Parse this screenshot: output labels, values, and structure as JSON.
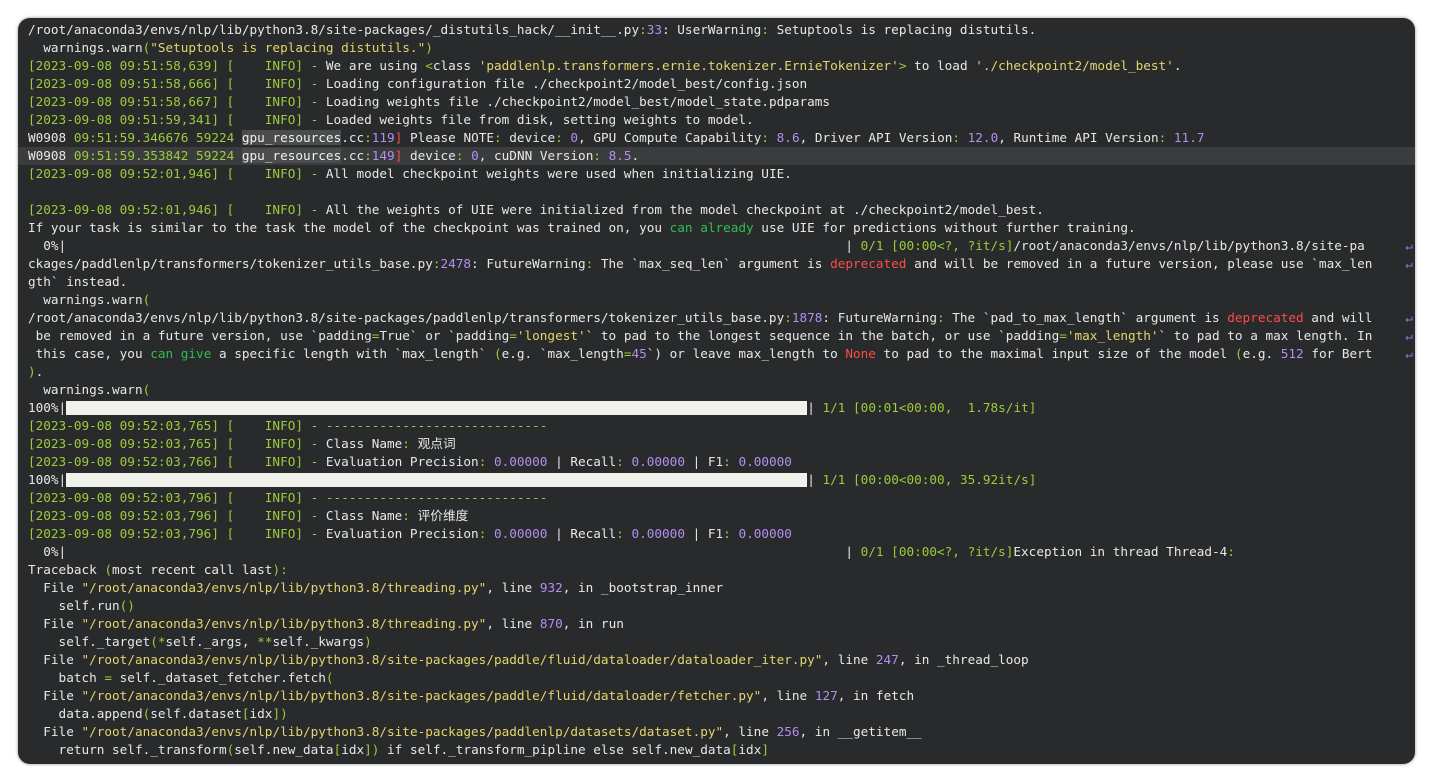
{
  "lines": [
    {
      "segs": [
        {
          "t": "/root/anaconda3/envs/nlp/lib/python3.8/site-packages/_distutils_hack/__init__.py"
        },
        {
          "t": ":",
          "c": "g"
        },
        {
          "t": "33",
          "c": "p"
        },
        {
          "t": ": UserWarning"
        },
        {
          "t": ":",
          "c": "g"
        },
        {
          "t": " Setuptools is replacing distutils."
        }
      ]
    },
    {
      "segs": [
        {
          "t": "  warnings.warn"
        },
        {
          "t": "(",
          "c": "g"
        },
        {
          "t": "\"Setuptools is replacing distutils.\"",
          "c": "y"
        },
        {
          "t": ")",
          "c": "g"
        }
      ]
    },
    {
      "segs": [
        {
          "t": "[2023-09-08 09:51:58,639] [    INFO] - ",
          "c": "g"
        },
        {
          "t": "We are using "
        },
        {
          "t": "<",
          "c": "g"
        },
        {
          "t": "class "
        },
        {
          "t": "'paddlenlp.transformers.ernie.tokenizer.ErnieTokenizer'",
          "c": "y"
        },
        {
          "t": ">",
          "c": "g"
        },
        {
          "t": " to load "
        },
        {
          "t": "'./checkpoint2/model_best'",
          "c": "y"
        },
        {
          "t": "."
        }
      ]
    },
    {
      "segs": [
        {
          "t": "[2023-09-08 09:51:58,666] [    INFO] - ",
          "c": "g"
        },
        {
          "t": "Loading configuration file ./checkpoint2/model_best/config.json"
        }
      ]
    },
    {
      "segs": [
        {
          "t": "[2023-09-08 09:51:58,667] [    INFO] - ",
          "c": "g"
        },
        {
          "t": "Loading weights file ./checkpoint2/model_best/model_state.pdparams"
        }
      ]
    },
    {
      "segs": [
        {
          "t": "[2023-09-08 09:51:59,341] [    INFO] - ",
          "c": "g"
        },
        {
          "t": "Loaded weights file from disk, setting weights to model."
        }
      ]
    },
    {
      "segs": [
        {
          "t": "W0908 "
        },
        {
          "t": "09:51:59.346676 59224",
          "c": "g"
        },
        {
          "t": " "
        },
        {
          "t": "gpu_resources",
          "c": "gb"
        },
        {
          "t": ".cc"
        },
        {
          "t": ":",
          "c": "g"
        },
        {
          "t": "119",
          "c": "p"
        },
        {
          "t": "]",
          "c": "r"
        },
        {
          "t": " Please NOTE"
        },
        {
          "t": ":",
          "c": "g"
        },
        {
          "t": " device"
        },
        {
          "t": ":",
          "c": "g"
        },
        {
          "t": " "
        },
        {
          "t": "0",
          "c": "p"
        },
        {
          "t": ", GPU Compute Capability"
        },
        {
          "t": ":",
          "c": "g"
        },
        {
          "t": " "
        },
        {
          "t": "8.6",
          "c": "p"
        },
        {
          "t": ", Driver API Version"
        },
        {
          "t": ":",
          "c": "g"
        },
        {
          "t": " "
        },
        {
          "t": "12.0",
          "c": "p"
        },
        {
          "t": ", Runtime API Version"
        },
        {
          "t": ":",
          "c": "g"
        },
        {
          "t": " "
        },
        {
          "t": "11.7",
          "c": "p"
        }
      ]
    },
    {
      "hl": true,
      "segs": [
        {
          "t": "W0908 "
        },
        {
          "t": "09:51:59.353842 59224",
          "c": "g"
        },
        {
          "t": " "
        },
        {
          "t": "gpu_resources",
          "c": "gb"
        },
        {
          "t": ".cc"
        },
        {
          "t": ":",
          "c": "g"
        },
        {
          "t": "149",
          "c": "p"
        },
        {
          "t": "]",
          "c": "r"
        },
        {
          "t": " device"
        },
        {
          "t": ":",
          "c": "g"
        },
        {
          "t": " "
        },
        {
          "t": "0",
          "c": "p"
        },
        {
          "t": ", cuDNN Version"
        },
        {
          "t": ":",
          "c": "g"
        },
        {
          "t": " "
        },
        {
          "t": "8.5",
          "c": "p"
        },
        {
          "t": "."
        }
      ]
    },
    {
      "segs": [
        {
          "t": "[2023-09-08 09:52:01,946] [    INFO] - ",
          "c": "g"
        },
        {
          "t": "All model checkpoint weights were used when initializing UIE."
        }
      ]
    },
    {
      "segs": [
        {
          "t": " "
        }
      ]
    },
    {
      "segs": [
        {
          "t": "[2023-09-08 09:52:01,946] [    INFO] - ",
          "c": "g"
        },
        {
          "t": "All the weights of UIE were initialized from the model checkpoint at ./checkpoint2/model_best."
        }
      ]
    },
    {
      "segs": [
        {
          "t": "If your task is similar to the task the model of the checkpoint was trained on, you "
        },
        {
          "t": "can already",
          "c": "gr"
        },
        {
          "t": " use UIE for predictions without further training."
        }
      ]
    },
    {
      "wrap": true,
      "segs": [
        {
          "t": "  0%|"
        },
        {
          "pad": 102
        },
        {
          "t": "| "
        },
        {
          "t": "0/1 [00:00<?, ?it/s]",
          "c": "g"
        },
        {
          "t": "/root/anaconda3/envs/nlp/lib/python3.8/site-pa"
        }
      ]
    },
    {
      "wrap": true,
      "segs": [
        {
          "t": "ckages/paddlenlp/transformers/tokenizer_utils_base.py"
        },
        {
          "t": ":",
          "c": "g"
        },
        {
          "t": "2478",
          "c": "p"
        },
        {
          "t": ": FutureWarning"
        },
        {
          "t": ":",
          "c": "g"
        },
        {
          "t": " The `max_seq_len` argument is "
        },
        {
          "t": "deprecated",
          "c": "r"
        },
        {
          "t": " and will be removed in a future version, please use `max_len"
        }
      ]
    },
    {
      "segs": [
        {
          "t": "gth` instead."
        }
      ]
    },
    {
      "segs": [
        {
          "t": "  warnings.warn"
        },
        {
          "t": "(",
          "c": "g"
        }
      ]
    },
    {
      "wrap": true,
      "segs": [
        {
          "t": "/root/anaconda3/envs/nlp/lib/python3.8/site-packages/paddlenlp/transformers/tokenizer_utils_base.py"
        },
        {
          "t": ":",
          "c": "g"
        },
        {
          "t": "1878",
          "c": "p"
        },
        {
          "t": ": FutureWarning"
        },
        {
          "t": ":",
          "c": "g"
        },
        {
          "t": " The `pad_to_max_length` argument is "
        },
        {
          "t": "deprecated",
          "c": "r"
        },
        {
          "t": " and will"
        }
      ]
    },
    {
      "wrap": true,
      "segs": [
        {
          "t": " be removed in a future version, use `padding"
        },
        {
          "t": "=",
          "c": "g"
        },
        {
          "t": "True` or `padding"
        },
        {
          "t": "=",
          "c": "g"
        },
        {
          "t": "'longest'",
          "c": "y"
        },
        {
          "t": "` to pad to the longest sequence in the batch, or use `padding"
        },
        {
          "t": "=",
          "c": "g"
        },
        {
          "t": "'max_length'",
          "c": "y"
        },
        {
          "t": "` to pad to a max length. In"
        }
      ]
    },
    {
      "wrap": true,
      "segs": [
        {
          "t": " this case, you "
        },
        {
          "t": "can give",
          "c": "gr"
        },
        {
          "t": " a specific length with `max_length` "
        },
        {
          "t": "(",
          "c": "g"
        },
        {
          "t": "e.g. `max_length"
        },
        {
          "t": "=",
          "c": "g"
        },
        {
          "t": "45",
          "c": "p"
        },
        {
          "t": "`) or leave max_length to "
        },
        {
          "t": "None",
          "c": "r"
        },
        {
          "t": " to pad to the maximal input size of the model "
        },
        {
          "t": "(",
          "c": "g"
        },
        {
          "t": "e.g. "
        },
        {
          "t": "512",
          "c": "p"
        },
        {
          "t": " for Bert"
        }
      ]
    },
    {
      "segs": [
        {
          "t": ")",
          "c": "g"
        },
        {
          "t": "."
        }
      ]
    },
    {
      "segs": [
        {
          "t": "  warnings.warn"
        },
        {
          "t": "(",
          "c": "g"
        }
      ]
    },
    {
      "segs": [
        {
          "t": "100%|"
        },
        {
          "bar": true
        },
        {
          "t": "| "
        },
        {
          "t": "1/1 [00:01<00:00,  1.78s/it]",
          "c": "g"
        }
      ]
    },
    {
      "segs": [
        {
          "t": "[2023-09-08 09:52:03,765] [    INFO] - -----------------------------",
          "c": "g"
        }
      ]
    },
    {
      "segs": [
        {
          "t": "[2023-09-08 09:52:03,765] [    INFO] - ",
          "c": "g"
        },
        {
          "t": "Class Name"
        },
        {
          "t": ":",
          "c": "g"
        },
        {
          "t": " 观点词"
        }
      ]
    },
    {
      "segs": [
        {
          "t": "[2023-09-08 09:52:03,766] [    INFO] - ",
          "c": "g"
        },
        {
          "t": "Evaluation Precision"
        },
        {
          "t": ":",
          "c": "g"
        },
        {
          "t": " "
        },
        {
          "t": "0.00000",
          "c": "p"
        },
        {
          "t": " | Recall"
        },
        {
          "t": ":",
          "c": "g"
        },
        {
          "t": " "
        },
        {
          "t": "0.00000",
          "c": "p"
        },
        {
          "t": " | F1"
        },
        {
          "t": ":",
          "c": "g"
        },
        {
          "t": " "
        },
        {
          "t": "0.00000",
          "c": "p"
        }
      ]
    },
    {
      "segs": [
        {
          "t": "100%|"
        },
        {
          "bar": true
        },
        {
          "t": "| "
        },
        {
          "t": "1/1 [00:00<00:00, 35.92it/s]",
          "c": "g"
        }
      ]
    },
    {
      "segs": [
        {
          "t": "[2023-09-08 09:52:03,796] [    INFO] - -----------------------------",
          "c": "g"
        }
      ]
    },
    {
      "segs": [
        {
          "t": "[2023-09-08 09:52:03,796] [    INFO] - ",
          "c": "g"
        },
        {
          "t": "Class Name"
        },
        {
          "t": ":",
          "c": "g"
        },
        {
          "t": " 评价维度"
        }
      ]
    },
    {
      "segs": [
        {
          "t": "[2023-09-08 09:52:03,796] [    INFO] - ",
          "c": "g"
        },
        {
          "t": "Evaluation Precision"
        },
        {
          "t": ":",
          "c": "g"
        },
        {
          "t": " "
        },
        {
          "t": "0.00000",
          "c": "p"
        },
        {
          "t": " | Recall"
        },
        {
          "t": ":",
          "c": "g"
        },
        {
          "t": " "
        },
        {
          "t": "0.00000",
          "c": "p"
        },
        {
          "t": " | F1"
        },
        {
          "t": ":",
          "c": "g"
        },
        {
          "t": " "
        },
        {
          "t": "0.00000",
          "c": "p"
        }
      ]
    },
    {
      "segs": [
        {
          "t": "  0%|"
        },
        {
          "pad": 102
        },
        {
          "t": "| "
        },
        {
          "t": "0/1 [00:00<?, ?it/s]",
          "c": "g"
        },
        {
          "t": "Exception in thread Thread-4"
        },
        {
          "t": ":",
          "c": "g"
        }
      ]
    },
    {
      "segs": [
        {
          "t": "Traceback "
        },
        {
          "t": "(",
          "c": "g"
        },
        {
          "t": "most recent call last"
        },
        {
          "t": "):",
          "c": "g"
        }
      ]
    },
    {
      "segs": [
        {
          "t": "  File "
        },
        {
          "t": "\"/root/anaconda3/envs/nlp/lib/python3.8/threading.py\"",
          "c": "y"
        },
        {
          "t": ", line "
        },
        {
          "t": "932",
          "c": "p"
        },
        {
          "t": ", in _bootstrap_inner"
        }
      ]
    },
    {
      "segs": [
        {
          "t": "    self.run"
        },
        {
          "t": "()",
          "c": "g"
        }
      ]
    },
    {
      "segs": [
        {
          "t": "  File "
        },
        {
          "t": "\"/root/anaconda3/envs/nlp/lib/python3.8/threading.py\"",
          "c": "y"
        },
        {
          "t": ", line "
        },
        {
          "t": "870",
          "c": "p"
        },
        {
          "t": ", in run"
        }
      ]
    },
    {
      "segs": [
        {
          "t": "    self._target"
        },
        {
          "t": "(*",
          "c": "g"
        },
        {
          "t": "self._args, "
        },
        {
          "t": "**",
          "c": "g"
        },
        {
          "t": "self._kwargs"
        },
        {
          "t": ")",
          "c": "g"
        }
      ]
    },
    {
      "segs": [
        {
          "t": "  File "
        },
        {
          "t": "\"/root/anaconda3/envs/nlp/lib/python3.8/site-packages/paddle/fluid/dataloader/dataloader_iter.py\"",
          "c": "y"
        },
        {
          "t": ", line "
        },
        {
          "t": "247",
          "c": "p"
        },
        {
          "t": ", in _thread_loop"
        }
      ]
    },
    {
      "segs": [
        {
          "t": "    batch "
        },
        {
          "t": "=",
          "c": "g"
        },
        {
          "t": " self._dataset_fetcher.fetch"
        },
        {
          "t": "(",
          "c": "g"
        }
      ]
    },
    {
      "segs": [
        {
          "t": "  File "
        },
        {
          "t": "\"/root/anaconda3/envs/nlp/lib/python3.8/site-packages/paddle/fluid/dataloader/fetcher.py\"",
          "c": "y"
        },
        {
          "t": ", line "
        },
        {
          "t": "127",
          "c": "p"
        },
        {
          "t": ", in fetch"
        }
      ]
    },
    {
      "segs": [
        {
          "t": "    data.append"
        },
        {
          "t": "(",
          "c": "g"
        },
        {
          "t": "self.dataset"
        },
        {
          "t": "[",
          "c": "g"
        },
        {
          "t": "idx"
        },
        {
          "t": "])",
          "c": "g"
        }
      ]
    },
    {
      "segs": [
        {
          "t": "  File "
        },
        {
          "t": "\"/root/anaconda3/envs/nlp/lib/python3.8/site-packages/paddlenlp/datasets/dataset.py\"",
          "c": "y"
        },
        {
          "t": ", line "
        },
        {
          "t": "256",
          "c": "p"
        },
        {
          "t": ", in __getitem__"
        }
      ]
    },
    {
      "segs": [
        {
          "t": "    return self._transform"
        },
        {
          "t": "(",
          "c": "g"
        },
        {
          "t": "self.new_data"
        },
        {
          "t": "[",
          "c": "g"
        },
        {
          "t": "idx"
        },
        {
          "t": "])",
          "c": "g"
        },
        {
          "t": " if self._transform_pipline else self.new_data"
        },
        {
          "t": "[",
          "c": "g"
        },
        {
          "t": "idx"
        },
        {
          "t": "]",
          "c": "g"
        }
      ]
    }
  ],
  "progress_bars": [
    {
      "percent": 0,
      "count": "0/1"
    },
    {
      "percent": 100,
      "count": "1/1"
    },
    {
      "percent": 100,
      "count": "1/1"
    },
    {
      "percent": 0,
      "count": "0/1"
    }
  ],
  "wrap_glyph": "↵",
  "colors": {
    "background": "#282a2b",
    "text": "#e8e8e8",
    "green_yellow": "#9ccc3c",
    "green": "#2fbf4f",
    "yellow": "#e6d46c",
    "purple": "#b48ef0",
    "red": "#ff4a4a"
  }
}
